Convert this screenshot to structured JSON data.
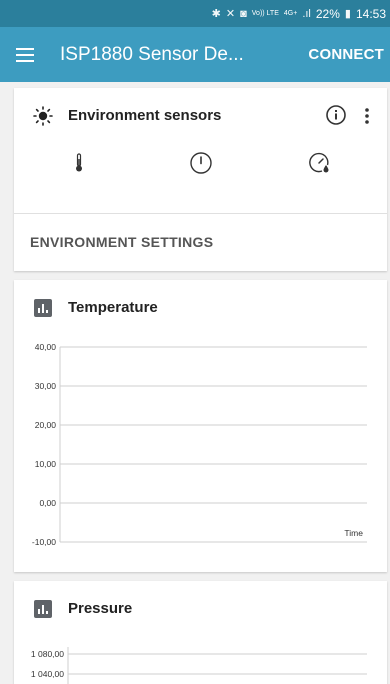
{
  "status_bar": {
    "battery_percent": "22%",
    "time": "14:53",
    "network_1": "Vo)) LTE",
    "network_2": "4G+"
  },
  "app_bar": {
    "title": "ISP1880 Sensor De...",
    "connect_label": "CONNECT"
  },
  "environment_card": {
    "title": "Environment sensors",
    "sensor_icons": [
      "thermometer-icon",
      "compass-icon",
      "pressure-gauge-icon"
    ],
    "settings_label": "ENVIRONMENT SETTINGS"
  },
  "temperature_card": {
    "title": "Temperature",
    "time_label": "Time"
  },
  "pressure_card": {
    "title": "Pressure"
  },
  "chart_data": [
    {
      "type": "line",
      "title": "Temperature",
      "xlabel": "Time",
      "ylabel": "",
      "ylim": [
        -10,
        40
      ],
      "y_ticks": [
        "40,00",
        "30,00",
        "20,00",
        "10,00",
        "0,00",
        "-10,00"
      ],
      "series": [],
      "grid": true
    },
    {
      "type": "line",
      "title": "Pressure",
      "xlabel": "",
      "ylabel": "",
      "y_ticks": [
        "1 080,00",
        "1 040,00"
      ],
      "series": [],
      "grid": true
    }
  ],
  "colors": {
    "status_bar": "#2b7f9c",
    "app_bar": "#3d9cc0",
    "background": "#f1f1f1",
    "card": "#ffffff"
  }
}
